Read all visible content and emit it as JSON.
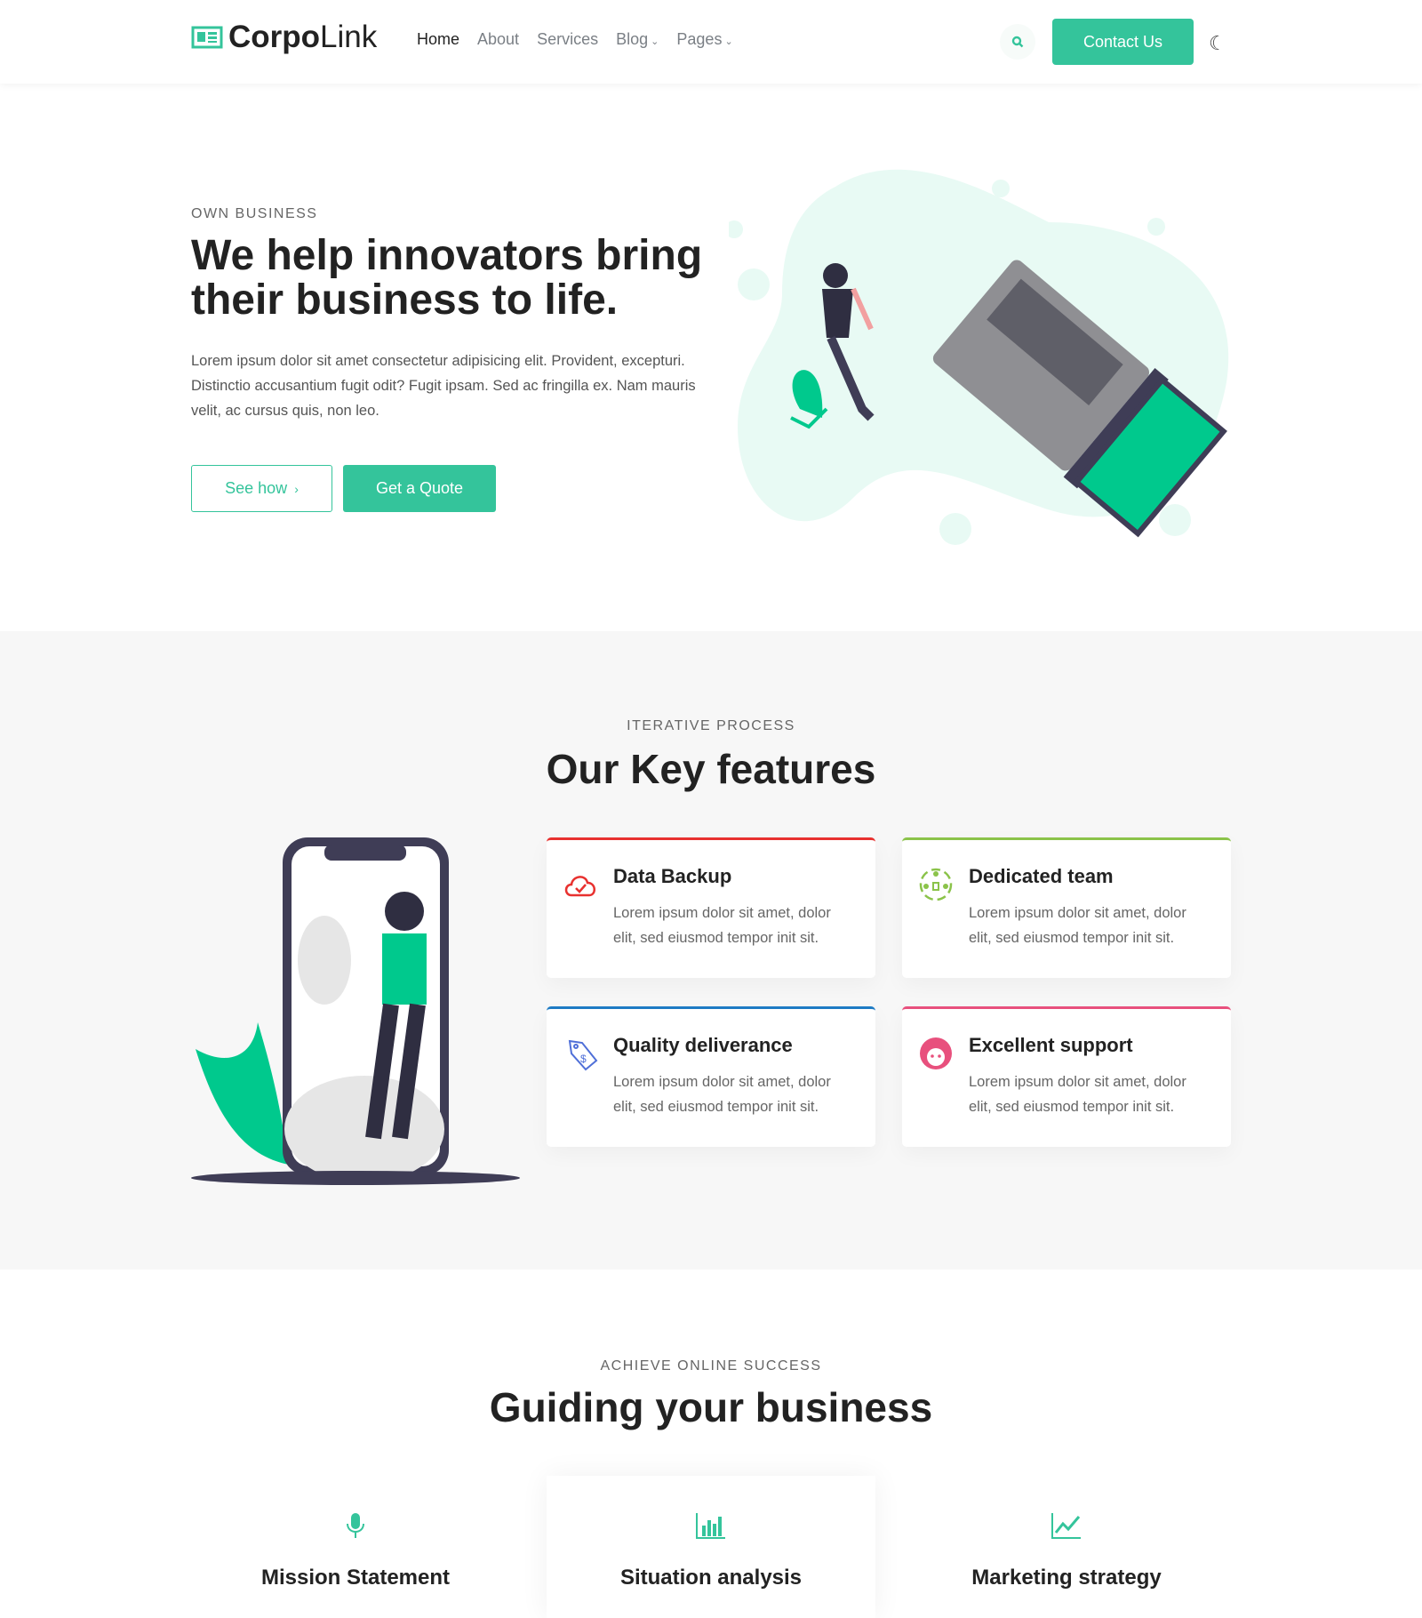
{
  "nav": {
    "logo_bold": "Corpo",
    "logo_light": "Link",
    "items": [
      "Home",
      "About",
      "Services",
      "Blog",
      "Pages"
    ],
    "contact": "Contact Us"
  },
  "hero": {
    "eyebrow": "OWN BUSINESS",
    "title_1": "We help innovators bring",
    "title_2": "their business to life.",
    "text": "Lorem ipsum dolor sit amet consectetur adipisicing elit. Provident, excepturi. Distinctio accusantium fugit odit? Fugit ipsam. Sed ac fringilla ex. Nam mauris velit, ac cursus quis, non leo.",
    "see_how": "See how",
    "quote": "Get a Quote",
    "accent": "#34c49b"
  },
  "features": {
    "eyebrow": "ITERATIVE PROCESS",
    "title": "Our Key features",
    "cards": [
      {
        "title": "Data Backup",
        "text": "Lorem ipsum dolor sit amet, dolor elit, sed eiusmod tempor init sit.",
        "color": "#e8312f"
      },
      {
        "title": "Dedicated team",
        "text": "Lorem ipsum dolor sit amet, dolor elit, sed eiusmod tempor init sit.",
        "color": "#8bc34a"
      },
      {
        "title": "Quality deliverance",
        "text": "Lorem ipsum dolor sit amet, dolor elit, sed eiusmod tempor init sit.",
        "color": "#1e7bc4"
      },
      {
        "title": "Excellent support",
        "text": "Lorem ipsum dolor sit amet, dolor elit, sed eiusmod tempor init sit.",
        "color": "#e8507d"
      }
    ]
  },
  "guiding": {
    "eyebrow": "ACHIEVE ONLINE SUCCESS",
    "title": "Guiding your business",
    "items": [
      "Mission Statement",
      "Situation analysis",
      "Marketing strategy"
    ]
  }
}
